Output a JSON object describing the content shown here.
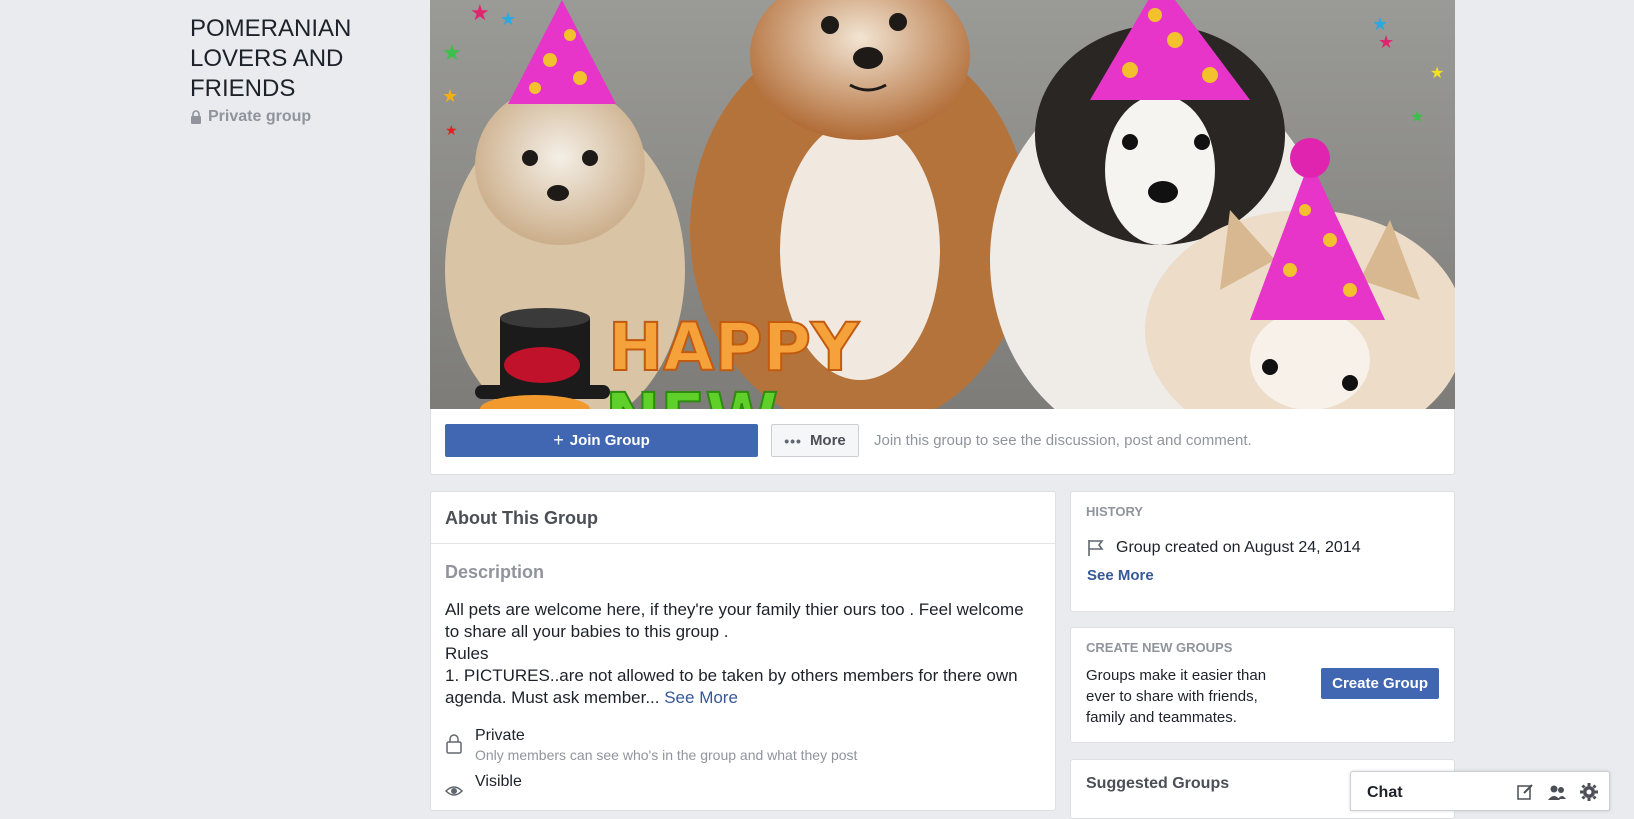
{
  "group": {
    "name": "POMERANIAN LOVERS AND FRIENDS",
    "privacy_label": "Private group"
  },
  "cover": {
    "overlay_text_line1": "HAPPY",
    "overlay_text_line2": "NEW"
  },
  "actions": {
    "join_label": "Join Group",
    "more_label": "More",
    "hint": "Join this group to see the discussion, post and comment."
  },
  "about": {
    "title": "About This Group",
    "description_heading": "Description",
    "description": "All pets are welcome here, if they're your family thier ours too . Feel welcome to share all your babies to this group .\nRules\n1. PICTURES..are not allowed to be taken by others members for there own agenda.  Must ask  member... ",
    "see_more": "See More",
    "privacy_items": [
      {
        "title": "Private",
        "subtitle": "Only members can see who's in the group and what they post",
        "icon": "lock-icon"
      },
      {
        "title": "Visible",
        "subtitle": "",
        "icon": "eye-icon"
      }
    ]
  },
  "history": {
    "heading": "HISTORY",
    "created": "Group created on August 24, 2014",
    "see_more": "See More"
  },
  "create_groups": {
    "heading": "CREATE NEW GROUPS",
    "text": "Groups make it easier than ever to share with friends, family and teammates.",
    "button": "Create Group"
  },
  "suggested": {
    "heading": "Suggested Groups"
  },
  "chat": {
    "label": "Chat",
    "icons": [
      "compose-icon",
      "people-icon",
      "gear-icon"
    ]
  },
  "colors": {
    "primary": "#4267b2",
    "link": "#365899",
    "background": "#e9ebee",
    "muted": "#90949c"
  }
}
